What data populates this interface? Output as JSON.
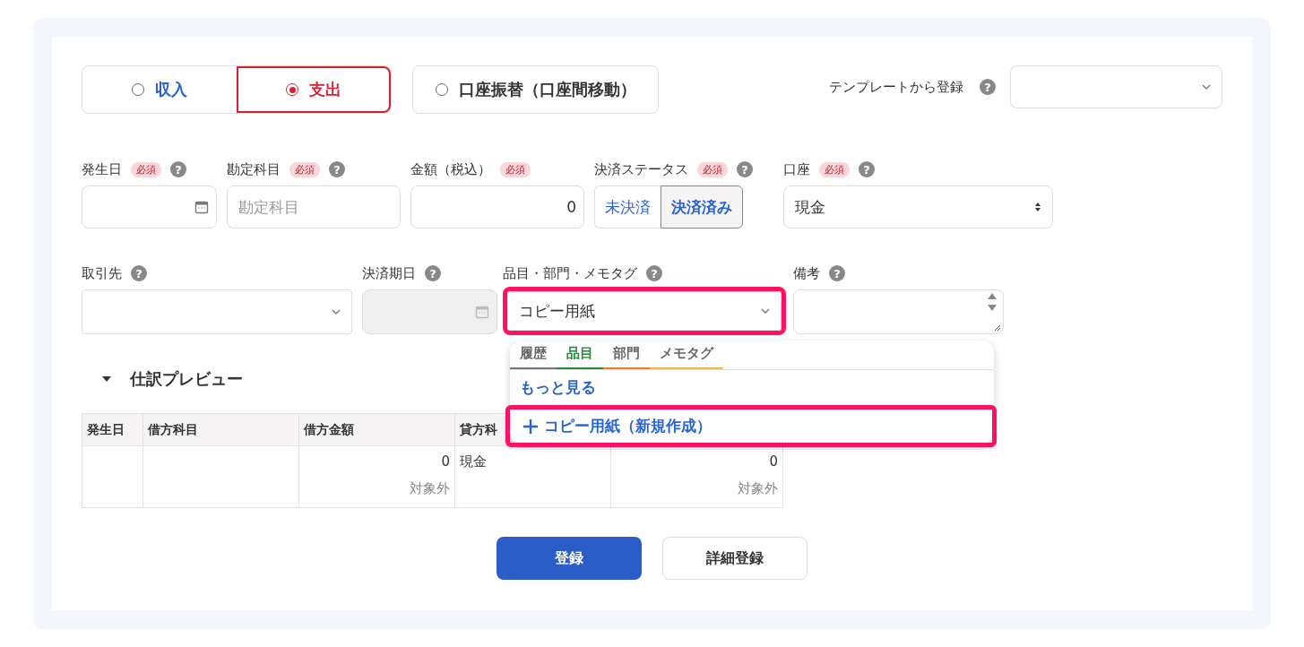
{
  "entry_types": [
    {
      "label": "収入",
      "selected": false
    },
    {
      "label": "支出",
      "selected": true
    },
    {
      "label": "口座振替（口座間移動）",
      "selected": false
    }
  ],
  "template": {
    "label": "テンプレートから登録",
    "help": "?"
  },
  "fields_row_1": [
    {
      "kind": "date",
      "label": "発生日",
      "required": "必須",
      "help": "?"
    },
    {
      "kind": "text",
      "label": "勘定科目",
      "required": "必須",
      "help": "?",
      "placeholder": "勘定科目"
    },
    {
      "kind": "amount",
      "label": "金額（税込）",
      "required": "必須",
      "value": "0"
    },
    {
      "kind": "toggle",
      "label": "決済ステータス",
      "required": "必須",
      "help": "?",
      "options": [
        {
          "label": "未決済",
          "selected": false
        },
        {
          "label": "決済済み",
          "selected": true
        }
      ]
    },
    {
      "kind": "select",
      "label": "口座",
      "required": "必須",
      "help": "?",
      "value": "現金"
    }
  ],
  "fields_row_2": [
    {
      "kind": "combo",
      "label": "取引先",
      "help": "?"
    },
    {
      "kind": "date_disabled",
      "label": "決済期日",
      "help": "?"
    },
    {
      "kind": "combo",
      "label": "品目・部門・メモタグ",
      "help": "?",
      "value": "コピー用紙",
      "highlighted": true
    },
    {
      "kind": "textarea",
      "label": "備考",
      "help": "?"
    }
  ],
  "tag_dropdown": {
    "tabs": [
      {
        "label": "履歴",
        "selected": false,
        "color": "#777777"
      },
      {
        "label": "品目",
        "selected": true,
        "color": "#1e8a3c"
      },
      {
        "label": "部門",
        "selected": false,
        "color": "#f07a2a"
      },
      {
        "label": "メモタグ",
        "selected": false,
        "color": "#f6b935"
      }
    ],
    "more_link": "もっと見る",
    "create_item": {
      "label": "コピー用紙（新規作成）",
      "highlighted": true
    }
  },
  "preview": {
    "title": "仕訳プレビュー",
    "expanded": true,
    "columns": [
      "発生日",
      "借方科目",
      "借方金額",
      "貸方科"
    ],
    "rows": [
      {
        "debit_amount": "0",
        "debit_tax": "対象外",
        "credit_account": "現金",
        "credit_amount": "0",
        "credit_tax": "対象外"
      }
    ]
  },
  "buttons": [
    {
      "kind": "primary",
      "label": "登録"
    },
    {
      "kind": "secondary",
      "label": "詳細登録"
    }
  ]
}
